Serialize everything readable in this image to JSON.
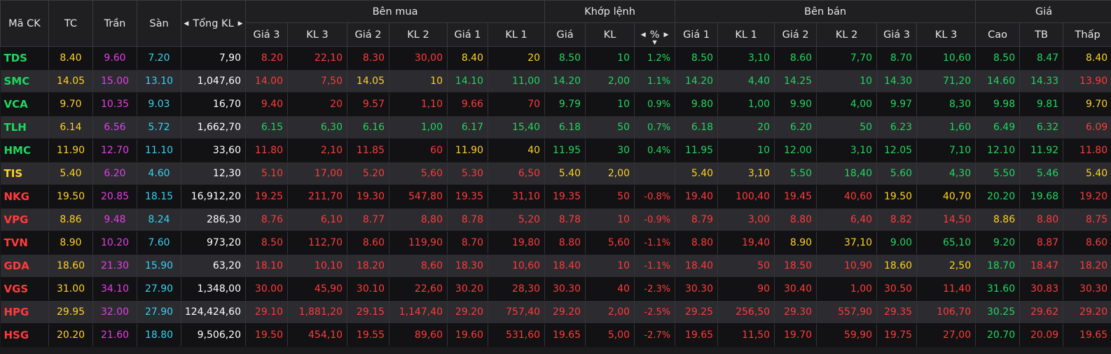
{
  "header": {
    "symbol": "Mã CK",
    "ref": "TC",
    "ceiling": "Trần",
    "floor": "Sàn",
    "total_vol": "Tổng KL",
    "buy_group": "Bên mua",
    "match_group": "Khớp lệnh",
    "sell_group": "Bên bán",
    "price_group": "Giá",
    "sub": [
      "Giá 3",
      "KL 3",
      "Giá 2",
      "KL 2",
      "Giá 1",
      "KL 1",
      "Giá",
      "KL",
      "%",
      "Giá 1",
      "KL 1",
      "Giá 2",
      "KL 2",
      "Giá 3",
      "KL 3",
      "Cao",
      "TB",
      "Thấp"
    ]
  },
  "colors": {
    "up": "#1ed760",
    "down": "#ff3b3b",
    "ref": "#ffd21f",
    "ceiling": "#e63ee6",
    "floor": "#37d2f0"
  },
  "rows": [
    {
      "sym": [
        "TDS",
        "up"
      ],
      "tc": "8.40",
      "tran": "9.60",
      "san": "7.20",
      "tkl": "7,90",
      "cells": [
        [
          "8.20",
          "down"
        ],
        [
          "22,10",
          "down"
        ],
        [
          "8.30",
          "down"
        ],
        [
          "30,00",
          "down"
        ],
        [
          "8.40",
          "ref"
        ],
        [
          "20",
          "ref"
        ],
        [
          "8.50",
          "up"
        ],
        [
          "10",
          "up"
        ],
        [
          "1.2%",
          "up"
        ],
        [
          "8.50",
          "up"
        ],
        [
          "3,10",
          "up"
        ],
        [
          "8.60",
          "up"
        ],
        [
          "7,70",
          "up"
        ],
        [
          "8.70",
          "up"
        ],
        [
          "10,60",
          "up"
        ],
        [
          "8.50",
          "up"
        ],
        [
          "8.47",
          "up"
        ],
        [
          "8.40",
          "ref"
        ]
      ]
    },
    {
      "sym": [
        "SMC",
        "up"
      ],
      "tc": "14.05",
      "tran": "15.00",
      "san": "13.10",
      "tkl": "1,047,60",
      "cells": [
        [
          "14.00",
          "down"
        ],
        [
          "7,50",
          "down"
        ],
        [
          "14.05",
          "ref"
        ],
        [
          "10",
          "ref"
        ],
        [
          "14.10",
          "up"
        ],
        [
          "11,00",
          "up"
        ],
        [
          "14.20",
          "up"
        ],
        [
          "2,00",
          "up"
        ],
        [
          "1.1%",
          "up"
        ],
        [
          "14.20",
          "up"
        ],
        [
          "4,40",
          "up"
        ],
        [
          "14.25",
          "up"
        ],
        [
          "10",
          "up"
        ],
        [
          "14.30",
          "up"
        ],
        [
          "71,20",
          "up"
        ],
        [
          "14.60",
          "up"
        ],
        [
          "14.33",
          "up"
        ],
        [
          "13.90",
          "down"
        ]
      ]
    },
    {
      "sym": [
        "VCA",
        "up"
      ],
      "tc": "9.70",
      "tran": "10.35",
      "san": "9.03",
      "tkl": "16,70",
      "cells": [
        [
          "9.40",
          "down"
        ],
        [
          "20",
          "down"
        ],
        [
          "9.57",
          "down"
        ],
        [
          "1,10",
          "down"
        ],
        [
          "9.66",
          "down"
        ],
        [
          "70",
          "down"
        ],
        [
          "9.79",
          "up"
        ],
        [
          "10",
          "up"
        ],
        [
          "0.9%",
          "up"
        ],
        [
          "9.80",
          "up"
        ],
        [
          "1,00",
          "up"
        ],
        [
          "9.90",
          "up"
        ],
        [
          "4,00",
          "up"
        ],
        [
          "9.97",
          "up"
        ],
        [
          "8,30",
          "up"
        ],
        [
          "9.98",
          "up"
        ],
        [
          "9.81",
          "up"
        ],
        [
          "9.70",
          "ref"
        ]
      ]
    },
    {
      "sym": [
        "TLH",
        "up"
      ],
      "tc": "6.14",
      "tran": "6.56",
      "san": "5.72",
      "tkl": "1,662,70",
      "cells": [
        [
          "6.15",
          "up"
        ],
        [
          "6,30",
          "up"
        ],
        [
          "6.16",
          "up"
        ],
        [
          "1,00",
          "up"
        ],
        [
          "6.17",
          "up"
        ],
        [
          "15,40",
          "up"
        ],
        [
          "6.18",
          "up"
        ],
        [
          "50",
          "up"
        ],
        [
          "0.7%",
          "up"
        ],
        [
          "6.18",
          "up"
        ],
        [
          "20",
          "up"
        ],
        [
          "6.20",
          "up"
        ],
        [
          "50",
          "up"
        ],
        [
          "6.23",
          "up"
        ],
        [
          "1,60",
          "up"
        ],
        [
          "6.49",
          "up"
        ],
        [
          "6.32",
          "up"
        ],
        [
          "6.09",
          "down"
        ]
      ]
    },
    {
      "sym": [
        "HMC",
        "up"
      ],
      "tc": "11.90",
      "tran": "12.70",
      "san": "11.10",
      "tkl": "33,60",
      "cells": [
        [
          "11.80",
          "down"
        ],
        [
          "2,10",
          "down"
        ],
        [
          "11.85",
          "down"
        ],
        [
          "60",
          "down"
        ],
        [
          "11.90",
          "ref"
        ],
        [
          "40",
          "ref"
        ],
        [
          "11.95",
          "up"
        ],
        [
          "30",
          "up"
        ],
        [
          "0.4%",
          "up"
        ],
        [
          "11.95",
          "up"
        ],
        [
          "10",
          "up"
        ],
        [
          "12.00",
          "up"
        ],
        [
          "3,10",
          "up"
        ],
        [
          "12.05",
          "up"
        ],
        [
          "7,10",
          "up"
        ],
        [
          "12.10",
          "up"
        ],
        [
          "11.92",
          "up"
        ],
        [
          "11.80",
          "down"
        ]
      ]
    },
    {
      "sym": [
        "TIS",
        "ref"
      ],
      "tc": "5.40",
      "tran": "6.20",
      "san": "4.60",
      "tkl": "12,30",
      "cells": [
        [
          "5.10",
          "down"
        ],
        [
          "17,00",
          "down"
        ],
        [
          "5.20",
          "down"
        ],
        [
          "5,60",
          "down"
        ],
        [
          "5.30",
          "down"
        ],
        [
          "6,50",
          "down"
        ],
        [
          "5.40",
          "ref"
        ],
        [
          "2,00",
          "ref"
        ],
        [
          "",
          "ref"
        ],
        [
          "5.40",
          "ref"
        ],
        [
          "3,10",
          "ref"
        ],
        [
          "5.50",
          "up"
        ],
        [
          "18,40",
          "up"
        ],
        [
          "5.60",
          "up"
        ],
        [
          "4,30",
          "up"
        ],
        [
          "5.50",
          "up"
        ],
        [
          "5.46",
          "up"
        ],
        [
          "5.40",
          "ref"
        ]
      ]
    },
    {
      "sym": [
        "NKG",
        "down"
      ],
      "tc": "19.50",
      "tran": "20.85",
      "san": "18.15",
      "tkl": "16,912,20",
      "cells": [
        [
          "19.25",
          "down"
        ],
        [
          "211,70",
          "down"
        ],
        [
          "19.30",
          "down"
        ],
        [
          "547,80",
          "down"
        ],
        [
          "19.35",
          "down"
        ],
        [
          "31,10",
          "down"
        ],
        [
          "19.35",
          "down"
        ],
        [
          "50",
          "down"
        ],
        [
          "-0.8%",
          "down"
        ],
        [
          "19.40",
          "down"
        ],
        [
          "100,40",
          "down"
        ],
        [
          "19.45",
          "down"
        ],
        [
          "40,60",
          "down"
        ],
        [
          "19.50",
          "ref"
        ],
        [
          "40,70",
          "ref"
        ],
        [
          "20.20",
          "up"
        ],
        [
          "19.68",
          "up"
        ],
        [
          "19.20",
          "down"
        ]
      ]
    },
    {
      "sym": [
        "VPG",
        "down"
      ],
      "tc": "8.86",
      "tran": "9.48",
      "san": "8.24",
      "tkl": "286,30",
      "cells": [
        [
          "8.76",
          "down"
        ],
        [
          "6,10",
          "down"
        ],
        [
          "8.77",
          "down"
        ],
        [
          "8,80",
          "down"
        ],
        [
          "8.78",
          "down"
        ],
        [
          "5,20",
          "down"
        ],
        [
          "8.78",
          "down"
        ],
        [
          "10",
          "down"
        ],
        [
          "-0.9%",
          "down"
        ],
        [
          "8.79",
          "down"
        ],
        [
          "3,00",
          "down"
        ],
        [
          "8.80",
          "down"
        ],
        [
          "6,40",
          "down"
        ],
        [
          "8.82",
          "down"
        ],
        [
          "14,50",
          "down"
        ],
        [
          "8.86",
          "ref"
        ],
        [
          "8.80",
          "down"
        ],
        [
          "8.75",
          "down"
        ]
      ]
    },
    {
      "sym": [
        "TVN",
        "down"
      ],
      "tc": "8.90",
      "tran": "10.20",
      "san": "7.60",
      "tkl": "973,20",
      "cells": [
        [
          "8.50",
          "down"
        ],
        [
          "112,70",
          "down"
        ],
        [
          "8.60",
          "down"
        ],
        [
          "119,90",
          "down"
        ],
        [
          "8.70",
          "down"
        ],
        [
          "19,80",
          "down"
        ],
        [
          "8.80",
          "down"
        ],
        [
          "5,60",
          "down"
        ],
        [
          "-1.1%",
          "down"
        ],
        [
          "8.80",
          "down"
        ],
        [
          "19,40",
          "down"
        ],
        [
          "8.90",
          "ref"
        ],
        [
          "37,10",
          "ref"
        ],
        [
          "9.00",
          "up"
        ],
        [
          "65,10",
          "up"
        ],
        [
          "9.20",
          "up"
        ],
        [
          "8.87",
          "down"
        ],
        [
          "8.60",
          "down"
        ]
      ]
    },
    {
      "sym": [
        "GDA",
        "down"
      ],
      "tc": "18.60",
      "tran": "21.30",
      "san": "15.90",
      "tkl": "63,20",
      "cells": [
        [
          "18.10",
          "down"
        ],
        [
          "10,10",
          "down"
        ],
        [
          "18.20",
          "down"
        ],
        [
          "8,60",
          "down"
        ],
        [
          "18.30",
          "down"
        ],
        [
          "10,60",
          "down"
        ],
        [
          "18.40",
          "down"
        ],
        [
          "10",
          "down"
        ],
        [
          "-1.1%",
          "down"
        ],
        [
          "18.40",
          "down"
        ],
        [
          "50",
          "down"
        ],
        [
          "18.50",
          "down"
        ],
        [
          "10,90",
          "down"
        ],
        [
          "18.60",
          "ref"
        ],
        [
          "2,50",
          "ref"
        ],
        [
          "18.70",
          "up"
        ],
        [
          "18.47",
          "down"
        ],
        [
          "18.20",
          "down"
        ]
      ]
    },
    {
      "sym": [
        "VGS",
        "down"
      ],
      "tc": "31.00",
      "tran": "34.10",
      "san": "27.90",
      "tkl": "1,348,00",
      "cells": [
        [
          "30.00",
          "down"
        ],
        [
          "45,90",
          "down"
        ],
        [
          "30.10",
          "down"
        ],
        [
          "22,60",
          "down"
        ],
        [
          "30.20",
          "down"
        ],
        [
          "28,30",
          "down"
        ],
        [
          "30.30",
          "down"
        ],
        [
          "40",
          "down"
        ],
        [
          "-2.3%",
          "down"
        ],
        [
          "30.30",
          "down"
        ],
        [
          "90",
          "down"
        ],
        [
          "30.40",
          "down"
        ],
        [
          "1,00",
          "down"
        ],
        [
          "30.50",
          "down"
        ],
        [
          "11,40",
          "down"
        ],
        [
          "31.60",
          "up"
        ],
        [
          "30.83",
          "down"
        ],
        [
          "30.30",
          "down"
        ]
      ]
    },
    {
      "sym": [
        "HPG",
        "down"
      ],
      "tc": "29.95",
      "tran": "32.00",
      "san": "27.90",
      "tkl": "124,424,60",
      "cells": [
        [
          "29.10",
          "down"
        ],
        [
          "1,881,20",
          "down"
        ],
        [
          "29.15",
          "down"
        ],
        [
          "1,147,40",
          "down"
        ],
        [
          "29.20",
          "down"
        ],
        [
          "757,40",
          "down"
        ],
        [
          "29.20",
          "down"
        ],
        [
          "2,00",
          "down"
        ],
        [
          "-2.5%",
          "down"
        ],
        [
          "29.25",
          "down"
        ],
        [
          "256,50",
          "down"
        ],
        [
          "29.30",
          "down"
        ],
        [
          "557,90",
          "down"
        ],
        [
          "29.35",
          "down"
        ],
        [
          "106,70",
          "down"
        ],
        [
          "30.25",
          "up"
        ],
        [
          "29.62",
          "down"
        ],
        [
          "29.20",
          "down"
        ]
      ]
    },
    {
      "sym": [
        "HSG",
        "down"
      ],
      "tc": "20.20",
      "tran": "21.60",
      "san": "18.80",
      "tkl": "9,506,20",
      "cells": [
        [
          "19.50",
          "down"
        ],
        [
          "454,10",
          "down"
        ],
        [
          "19.55",
          "down"
        ],
        [
          "89,60",
          "down"
        ],
        [
          "19.60",
          "down"
        ],
        [
          "531,60",
          "down"
        ],
        [
          "19.65",
          "down"
        ],
        [
          "5,00",
          "down"
        ],
        [
          "-2.7%",
          "down"
        ],
        [
          "19.65",
          "down"
        ],
        [
          "11,50",
          "down"
        ],
        [
          "19.70",
          "down"
        ],
        [
          "59,90",
          "down"
        ],
        [
          "19.75",
          "down"
        ],
        [
          "27,00",
          "down"
        ],
        [
          "20.70",
          "up"
        ],
        [
          "20.09",
          "down"
        ],
        [
          "19.65",
          "down"
        ]
      ]
    }
  ]
}
